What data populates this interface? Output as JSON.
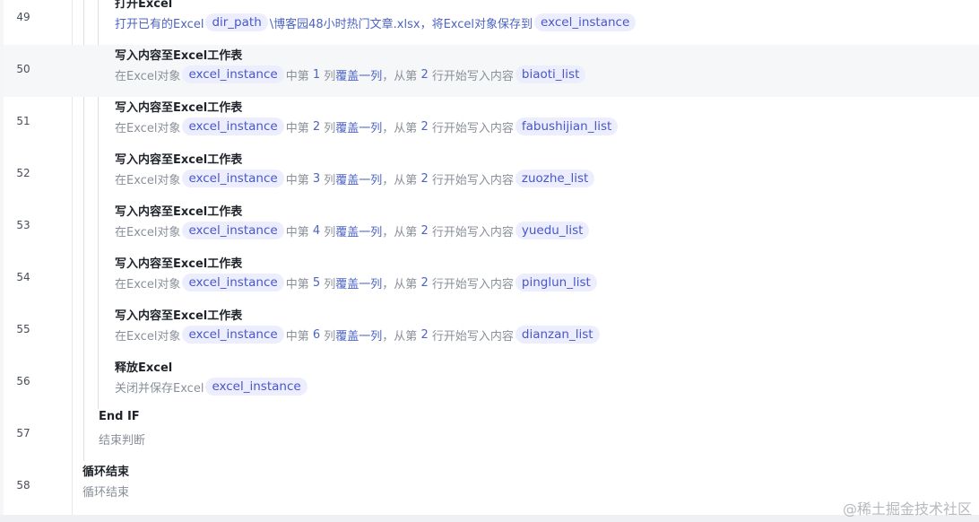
{
  "rows": [
    {
      "line": "49",
      "title": "打开Excel",
      "desc": {
        "p1": "打开已有的Excel",
        "c1": "dir_path",
        "p2": "\\博客园48小时热门文章.xlsx，将Excel对象保存到",
        "c2": "excel_instance"
      }
    },
    {
      "line": "50",
      "title": "写入内容至Excel工作表",
      "desc": {
        "p1": "在Excel对象",
        "c1": "excel_instance",
        "p2": "中第",
        "num": "1",
        "p3": "列",
        "kw": "覆盖一列",
        "p4": "，从第",
        "row": "2",
        "p5": "行开始写入内容",
        "c2": "biaoti_list"
      }
    },
    {
      "line": "51",
      "title": "写入内容至Excel工作表",
      "desc": {
        "p1": "在Excel对象",
        "c1": "excel_instance",
        "p2": "中第",
        "num": "2",
        "p3": "列",
        "kw": "覆盖一列",
        "p4": "，从第",
        "row": "2",
        "p5": "行开始写入内容",
        "c2": "fabushijian_list"
      }
    },
    {
      "line": "52",
      "title": "写入内容至Excel工作表",
      "desc": {
        "p1": "在Excel对象",
        "c1": "excel_instance",
        "p2": "中第",
        "num": "3",
        "p3": "列",
        "kw": "覆盖一列",
        "p4": "，从第",
        "row": "2",
        "p5": "行开始写入内容",
        "c2": "zuozhe_list"
      }
    },
    {
      "line": "53",
      "title": "写入内容至Excel工作表",
      "desc": {
        "p1": "在Excel对象",
        "c1": "excel_instance",
        "p2": "中第",
        "num": "4",
        "p3": "列",
        "kw": "覆盖一列",
        "p4": "，从第",
        "row": "2",
        "p5": "行开始写入内容",
        "c2": "yuedu_list"
      }
    },
    {
      "line": "54",
      "title": "写入内容至Excel工作表",
      "desc": {
        "p1": "在Excel对象",
        "c1": "excel_instance",
        "p2": "中第",
        "num": "5",
        "p3": "列",
        "kw": "覆盖一列",
        "p4": "，从第",
        "row": "2",
        "p5": "行开始写入内容",
        "c2": "pinglun_list"
      }
    },
    {
      "line": "55",
      "title": "写入内容至Excel工作表",
      "desc": {
        "p1": "在Excel对象",
        "c1": "excel_instance",
        "p2": "中第",
        "num": "6",
        "p3": "列",
        "kw": "覆盖一列",
        "p4": "，从第",
        "row": "2",
        "p5": "行开始写入内容",
        "c2": "dianzan_list"
      }
    },
    {
      "line": "56",
      "title": "释放Excel",
      "desc": {
        "p1": "关闭并保存Excel",
        "c1": "excel_instance"
      }
    },
    {
      "line": "57",
      "title": "End IF",
      "desc": {
        "p1": "结束判断"
      }
    },
    {
      "line": "58",
      "title": "循环结束",
      "desc": {
        "p1": "循环结束"
      }
    }
  ],
  "watermark": "@稀土掘金技术社区"
}
